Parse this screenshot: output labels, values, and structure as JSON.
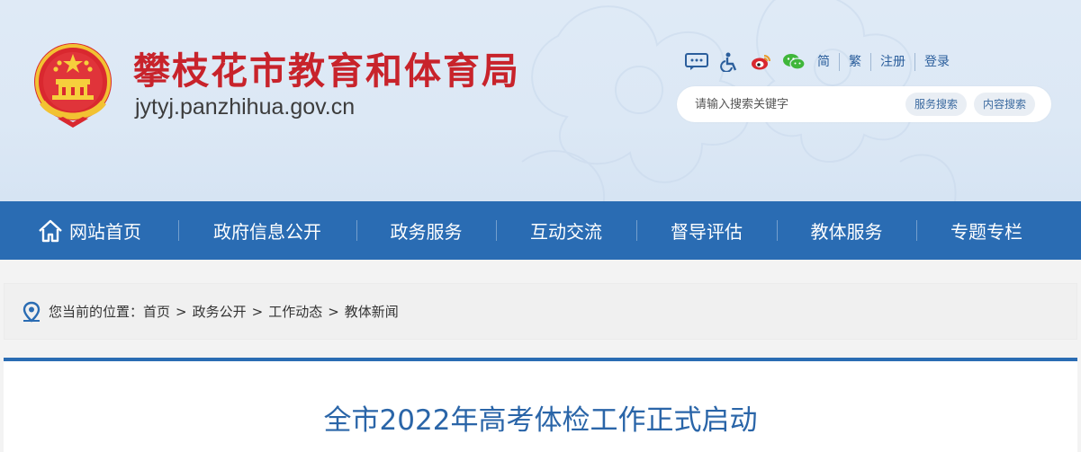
{
  "header": {
    "title": "攀枝花市教育和体育局",
    "domain": "jytyj.panzhihua.gov.cn",
    "title_color": "#c8232b",
    "emblem_icon": "national-emblem-icon"
  },
  "toolbar": {
    "icons": [
      "message-icon",
      "accessibility-icon",
      "weibo-icon",
      "wechat-icon"
    ],
    "links": [
      "简",
      "繁",
      "注册",
      "登录"
    ]
  },
  "search": {
    "placeholder": "请输入搜索关键字",
    "service_button": "服务搜索",
    "content_button": "内容搜索"
  },
  "nav": {
    "background": "#2a6cb3",
    "items": [
      {
        "label": "网站首页",
        "icon": "home-icon"
      },
      {
        "label": "政府信息公开"
      },
      {
        "label": "政务服务"
      },
      {
        "label": "互动交流"
      },
      {
        "label": "督导评估"
      },
      {
        "label": "教体服务"
      },
      {
        "label": "专题专栏"
      }
    ]
  },
  "breadcrumb": {
    "icon": "location-pin-icon",
    "prefix": "您当前的位置：",
    "items": [
      "首页",
      "政务公开",
      "工作动态",
      "教体新闻"
    ],
    "separator": ">"
  },
  "article": {
    "title": "全市2022年高考体检工作正式启动"
  }
}
